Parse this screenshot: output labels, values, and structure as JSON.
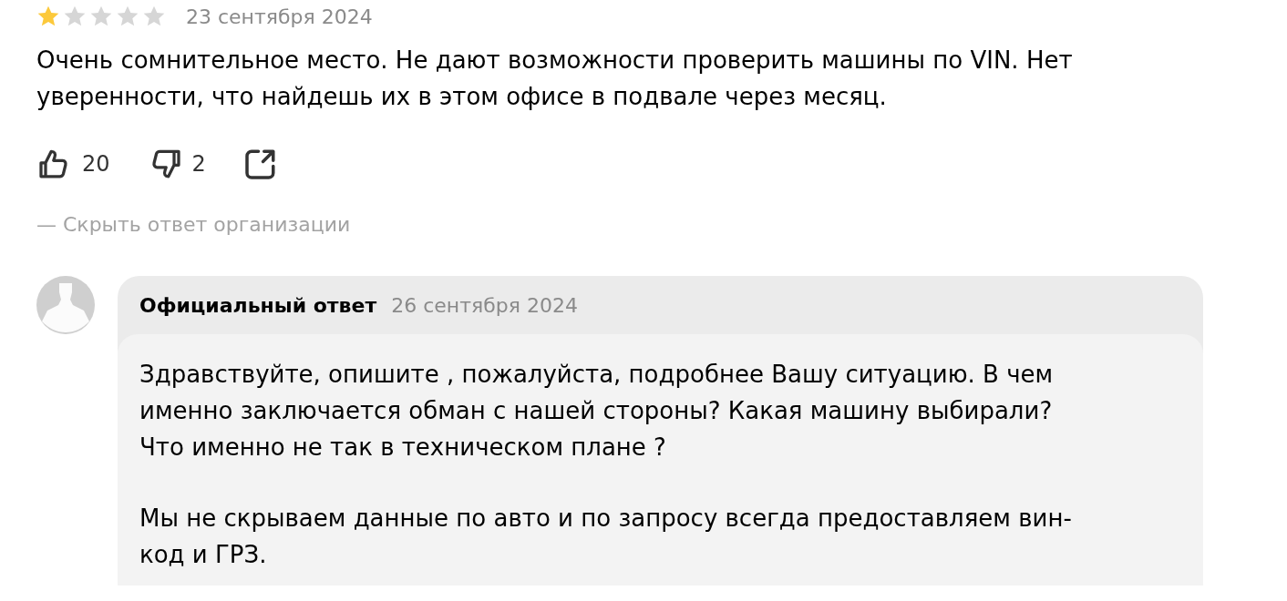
{
  "review": {
    "stars": 1,
    "date": "23 сентября 2024",
    "text_lines": [
      "Очень сомнительное место. Не дают возможности проверить машины по VIN. Нет",
      "уверенности, что найдешь их в этом офисе в подвале через месяц."
    ],
    "likes": "20",
    "dislikes": "2"
  },
  "hide_reply_link": "— Скрыть ответ организации",
  "reply": {
    "title": "Официальный ответ",
    "date": "26 сентября 2024",
    "paragraphs": [
      [
        "Здравствуйте, опишите , пожалуйста, подробнее Вашу ситуацию. В чем",
        "именно заключается обман с нашей стороны? Какая машину выбирали?",
        "Что именно не так в техническом плане ?"
      ],
      [
        "Мы не скрываем данные по авто и по запросу всегда предоставляем вин-",
        "код и ГРЗ."
      ]
    ]
  }
}
